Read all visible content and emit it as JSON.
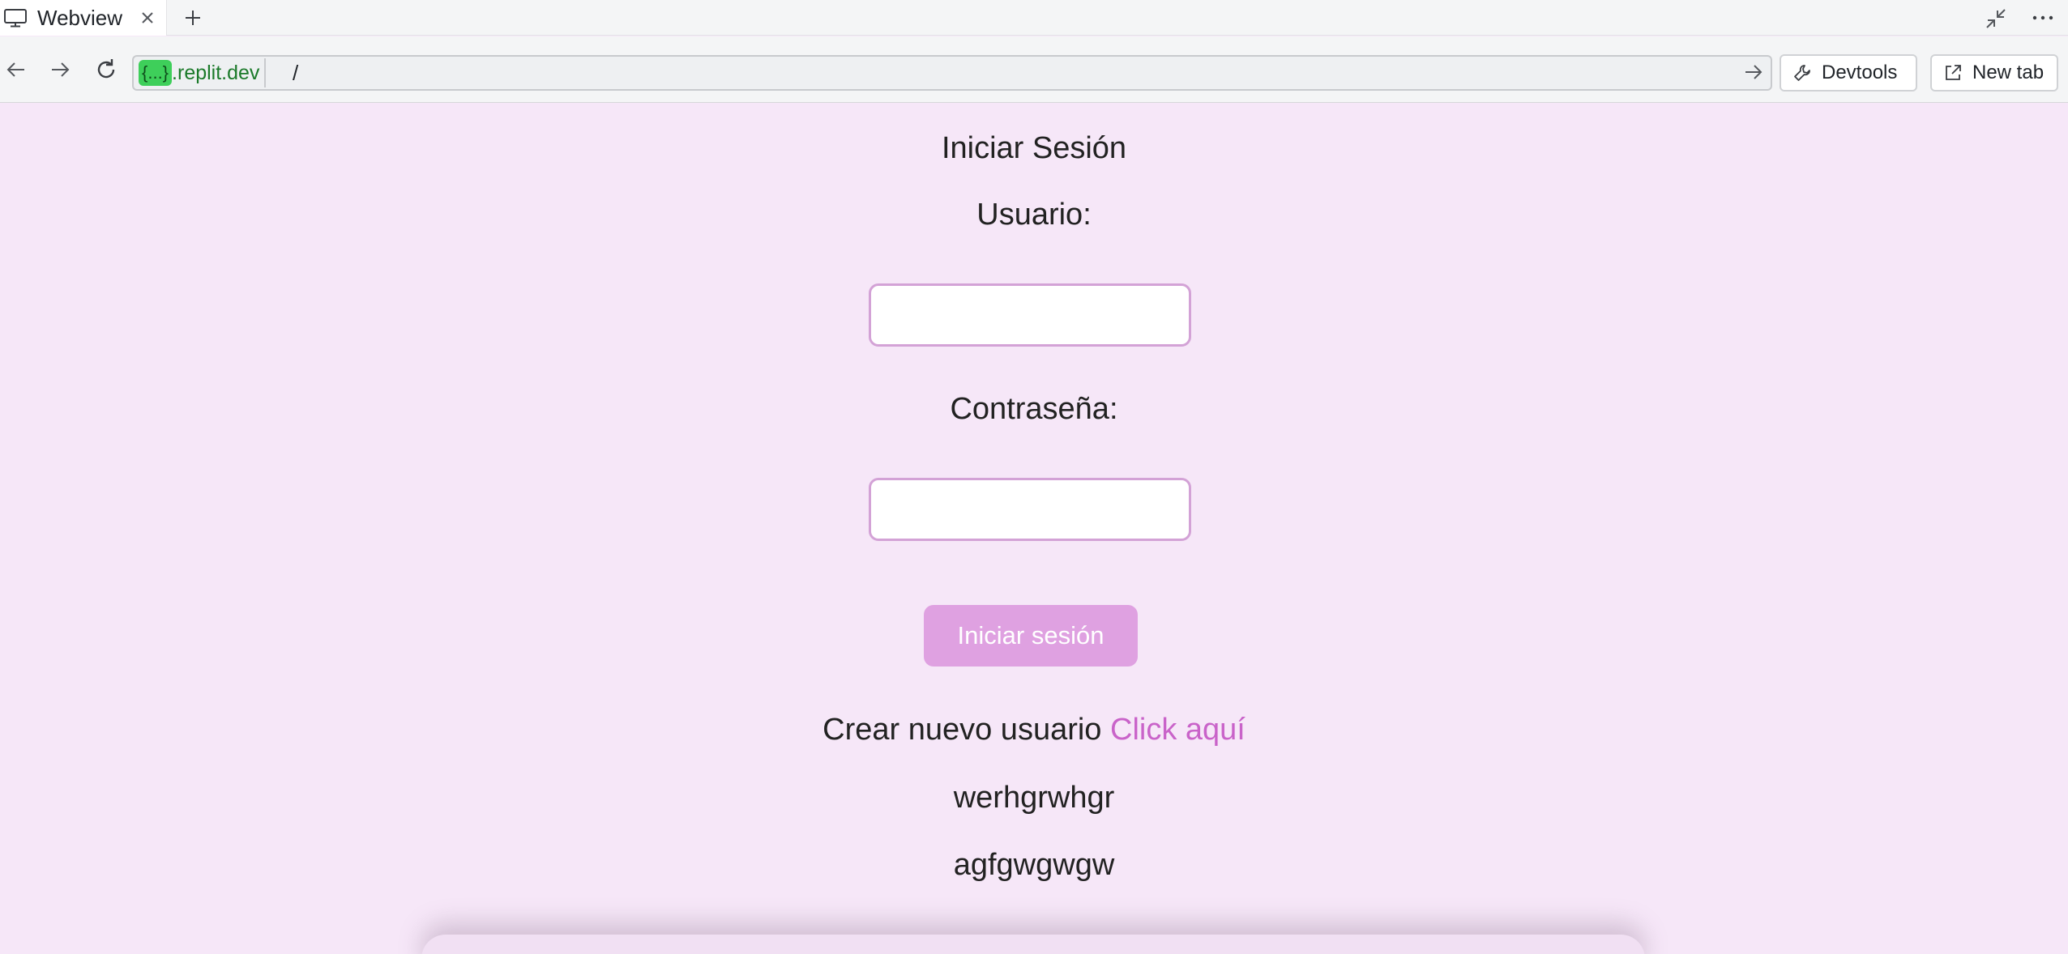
{
  "browser": {
    "tab": {
      "title": "Webview",
      "icon": "monitor-icon"
    },
    "address": {
      "host_badge": "{...}",
      "host_suffix": ".replit.dev",
      "path": "/"
    },
    "toolbar": {
      "devtools_label": "Devtools",
      "newtab_label": "New tab"
    }
  },
  "page": {
    "title": "Iniciar Sesión",
    "username_label": "Usuario:",
    "username_value": "",
    "password_label": "Contraseña:",
    "password_value": "",
    "submit_label": "Iniciar sesión",
    "create_prefix": "Crear nuevo usuario",
    "create_link": "Click aquí",
    "line1": "werhgrwhgr",
    "line2": "agfgwgwgw"
  },
  "colors": {
    "page_background": "#f6e7f8",
    "input_border": "#d3a2d6",
    "button": "#dfa1e1",
    "link": "#c963c9",
    "url_badge": "#3ecf5a"
  }
}
